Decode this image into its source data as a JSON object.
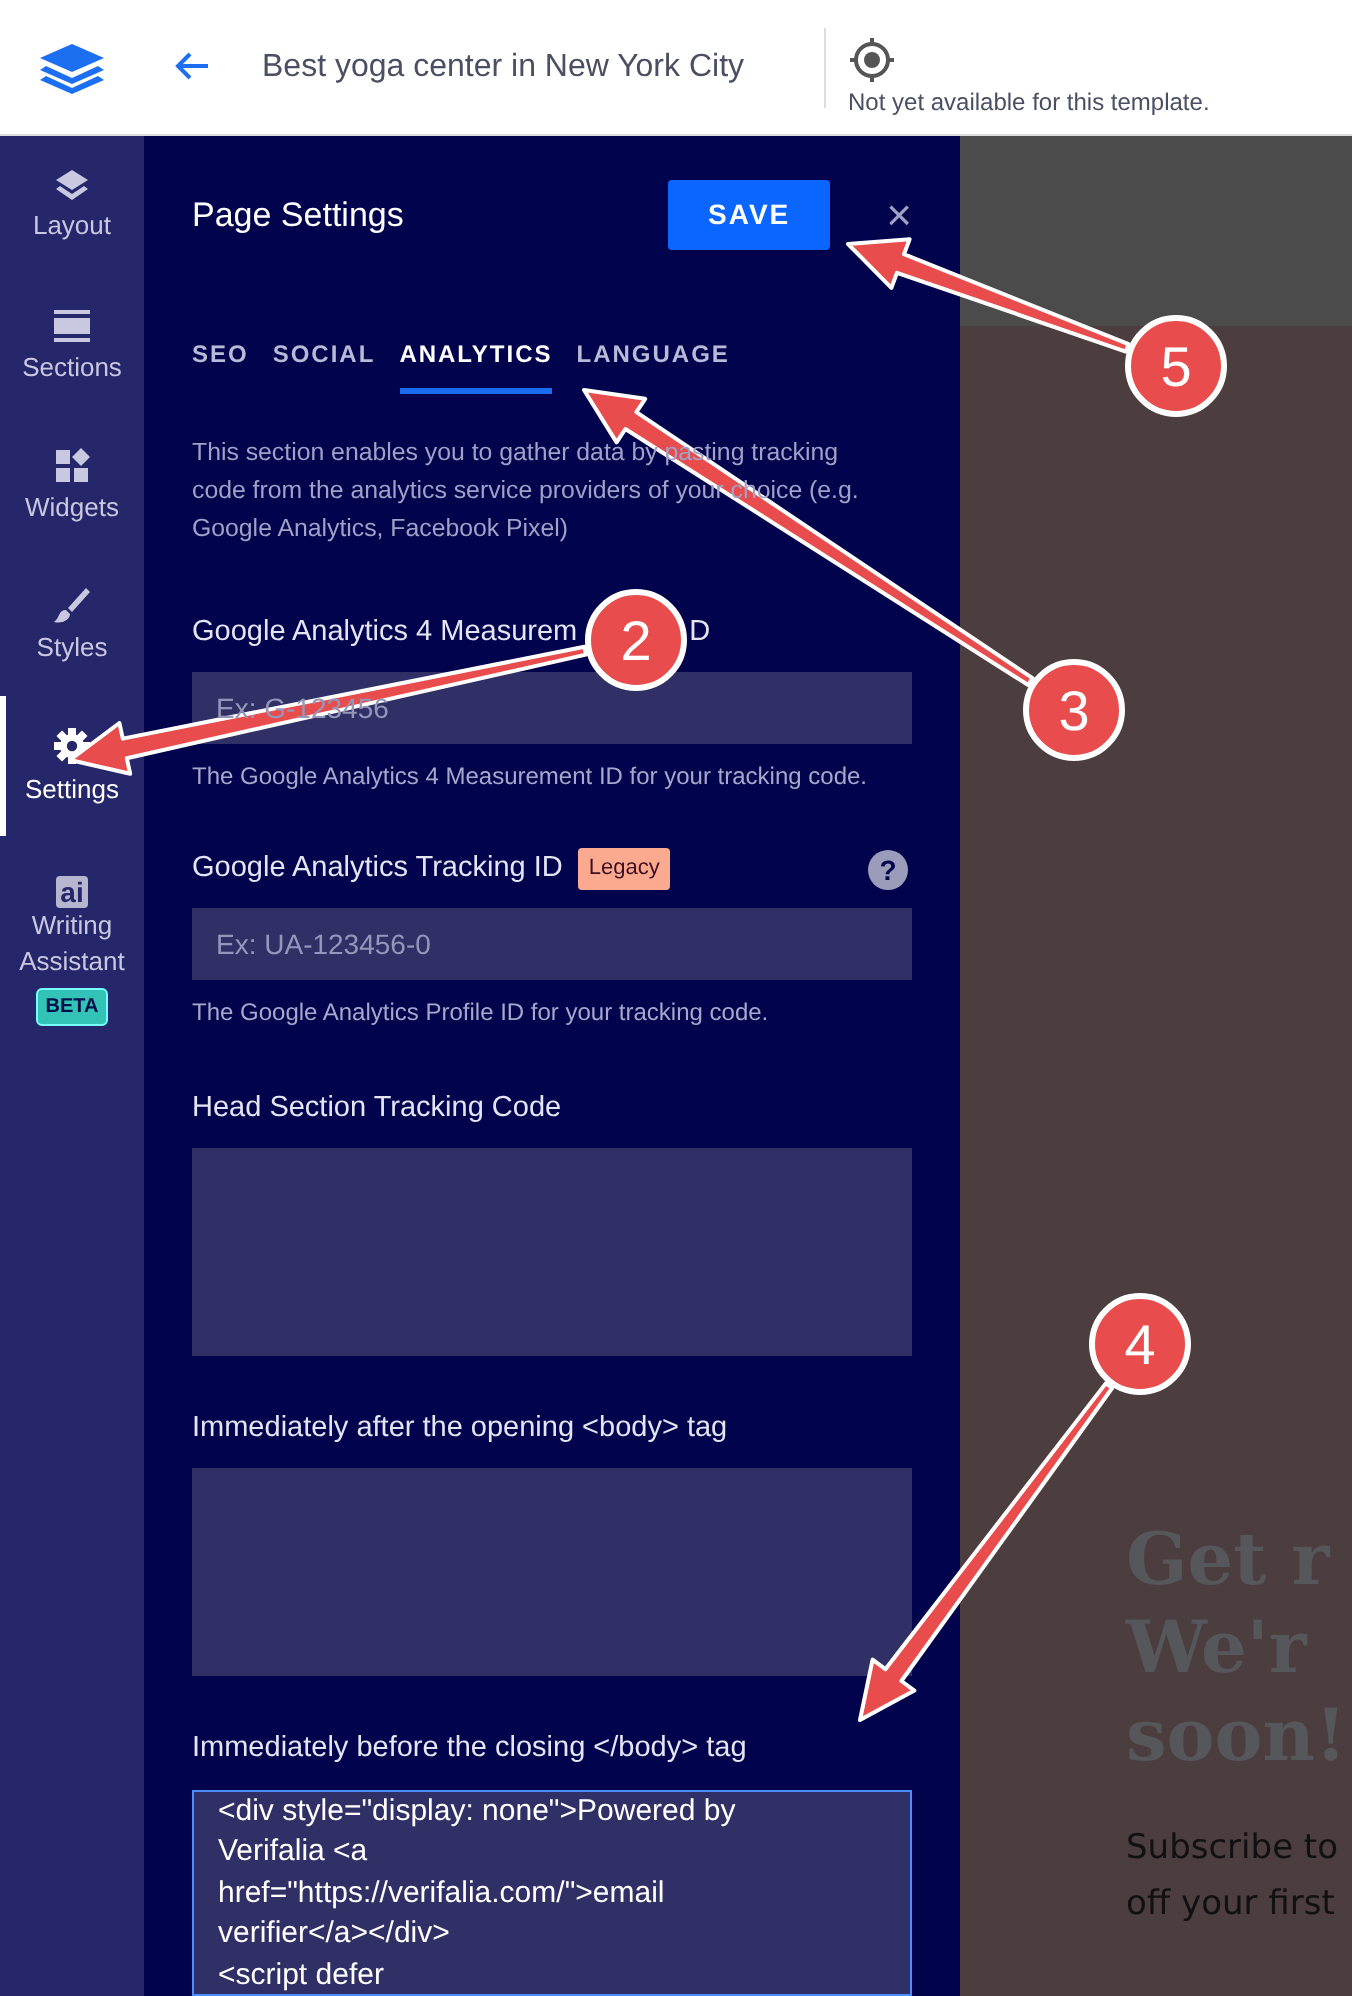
{
  "topbar": {
    "title": "Best yoga center in New York City",
    "status": "Not yet available for this template."
  },
  "rail": [
    {
      "kind": "layers",
      "label": "Layout",
      "selected": false
    },
    {
      "kind": "sections",
      "label": "Sections",
      "selected": false
    },
    {
      "kind": "widgets",
      "label": "Widgets",
      "selected": false
    },
    {
      "kind": "brush",
      "label": "Styles",
      "selected": false
    },
    {
      "kind": "gear",
      "label": "Settings",
      "selected": true
    },
    {
      "kind": "ai",
      "icon_text": "ai",
      "label": "Writing Assistant",
      "badge": "BETA",
      "selected": false
    }
  ],
  "panel": {
    "title": "Page Settings",
    "save": "SAVE",
    "close": "×",
    "tabs": [
      {
        "label": "SEO",
        "selected": false
      },
      {
        "label": "SOCIAL",
        "selected": false
      },
      {
        "label": "ANALYTICS",
        "selected": true
      },
      {
        "label": "LANGUAGE",
        "selected": false
      }
    ],
    "intro": "This section enables you to gather data by pasting tracking code from the analytics service providers of your choice (e.g. Google Analytics, Facebook Pixel)",
    "fields": [
      {
        "kind": "input",
        "label": "Google Analytics 4 Measurem",
        "label_tail": "D",
        "placeholder": "Ex: G-123456",
        "help": "The Google Analytics 4 Measurement ID for your tracking code."
      },
      {
        "kind": "input",
        "label": "Google Analytics Tracking ID",
        "tag": "Legacy",
        "info": "?",
        "placeholder": "Ex: UA-123456-0",
        "help": "The Google Analytics Profile ID for your tracking code."
      },
      {
        "kind": "area",
        "label": "Head Section Tracking Code"
      },
      {
        "kind": "area",
        "label": "Immediately after the opening <body> tag"
      },
      {
        "kind": "area",
        "label": "Immediately before the closing </body> tag",
        "focused": true,
        "value": "<div style=\"display: none\">Powered by Verifalia <a href=\"https://verifalia.com/\">email verifier</a></div>\n<script defer"
      }
    ]
  },
  "preview": {
    "heading": [
      "Get r",
      "We'r",
      "soon!"
    ],
    "text": [
      "Subscribe to",
      "off your first"
    ]
  },
  "callouts": [
    {
      "number": "2"
    },
    {
      "number": "3"
    },
    {
      "number": "4"
    },
    {
      "number": "5"
    }
  ]
}
